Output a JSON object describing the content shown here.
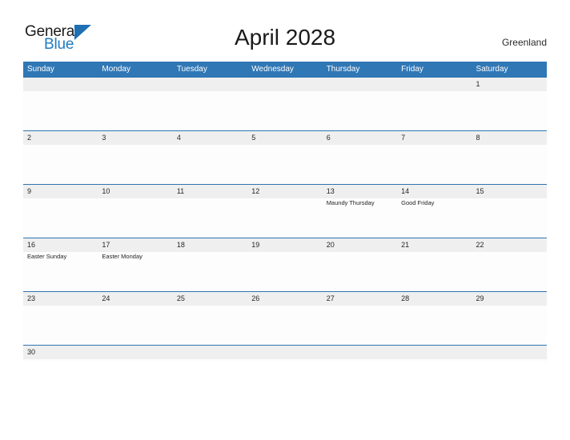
{
  "brand": {
    "name_part1": "General",
    "name_part2": "Blue",
    "flag_color": "#1f6fb4",
    "blue_text_color": "#1f7bc1"
  },
  "header": {
    "title": "April 2028",
    "location": "Greenland"
  },
  "theme": {
    "header_blue": "#3077b5",
    "row_border_blue": "#2f74b0",
    "day_band_gray": "#efefef",
    "cell_white": "#fdfdfd",
    "page_background": "#ffffff"
  },
  "calendar": {
    "month": "April",
    "year": "2028",
    "weekday_headers": [
      "Sunday",
      "Monday",
      "Tuesday",
      "Wednesday",
      "Thursday",
      "Friday",
      "Saturday"
    ],
    "weeks": [
      [
        {
          "date": "",
          "events": []
        },
        {
          "date": "",
          "events": []
        },
        {
          "date": "",
          "events": []
        },
        {
          "date": "",
          "events": []
        },
        {
          "date": "",
          "events": []
        },
        {
          "date": "",
          "events": []
        },
        {
          "date": "1",
          "events": []
        }
      ],
      [
        {
          "date": "2",
          "events": []
        },
        {
          "date": "3",
          "events": []
        },
        {
          "date": "4",
          "events": []
        },
        {
          "date": "5",
          "events": []
        },
        {
          "date": "6",
          "events": []
        },
        {
          "date": "7",
          "events": []
        },
        {
          "date": "8",
          "events": []
        }
      ],
      [
        {
          "date": "9",
          "events": []
        },
        {
          "date": "10",
          "events": []
        },
        {
          "date": "11",
          "events": []
        },
        {
          "date": "12",
          "events": []
        },
        {
          "date": "13",
          "events": [
            "Maundy Thursday"
          ]
        },
        {
          "date": "14",
          "events": [
            "Good Friday"
          ]
        },
        {
          "date": "15",
          "events": []
        }
      ],
      [
        {
          "date": "16",
          "events": [
            "Easter Sunday"
          ]
        },
        {
          "date": "17",
          "events": [
            "Easter Monday"
          ]
        },
        {
          "date": "18",
          "events": []
        },
        {
          "date": "19",
          "events": []
        },
        {
          "date": "20",
          "events": []
        },
        {
          "date": "21",
          "events": []
        },
        {
          "date": "22",
          "events": []
        }
      ],
      [
        {
          "date": "23",
          "events": []
        },
        {
          "date": "24",
          "events": []
        },
        {
          "date": "25",
          "events": []
        },
        {
          "date": "26",
          "events": []
        },
        {
          "date": "27",
          "events": []
        },
        {
          "date": "28",
          "events": []
        },
        {
          "date": "29",
          "events": []
        }
      ],
      [
        {
          "date": "30",
          "events": []
        },
        {
          "date": "",
          "events": []
        },
        {
          "date": "",
          "events": []
        },
        {
          "date": "",
          "events": []
        },
        {
          "date": "",
          "events": []
        },
        {
          "date": "",
          "events": []
        },
        {
          "date": "",
          "events": []
        }
      ]
    ]
  }
}
